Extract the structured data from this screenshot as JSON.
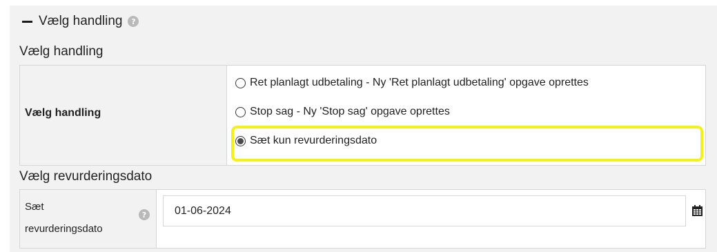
{
  "section": {
    "title": "Vælg handling",
    "help_glyph": "?"
  },
  "action_group": {
    "title": "Vælg handling",
    "label": "Vælg handling",
    "options": [
      {
        "label": "Ret planlagt udbetaling - Ny 'Ret planlagt udbetaling' opgave oprettes",
        "selected": false
      },
      {
        "label": "Stop sag - Ny 'Stop sag' opgave oprettes",
        "selected": false
      },
      {
        "label": "Sæt kun revurderingsdato",
        "selected": true
      }
    ],
    "highlight_color": "#f7ef1a"
  },
  "date_group": {
    "title": "Vælg revurderingsdato",
    "label_line1": "Sæt",
    "label_line2": "revurderingsdato",
    "help_glyph": "?",
    "value": "01-06-2024",
    "icon": "calendar-icon"
  }
}
